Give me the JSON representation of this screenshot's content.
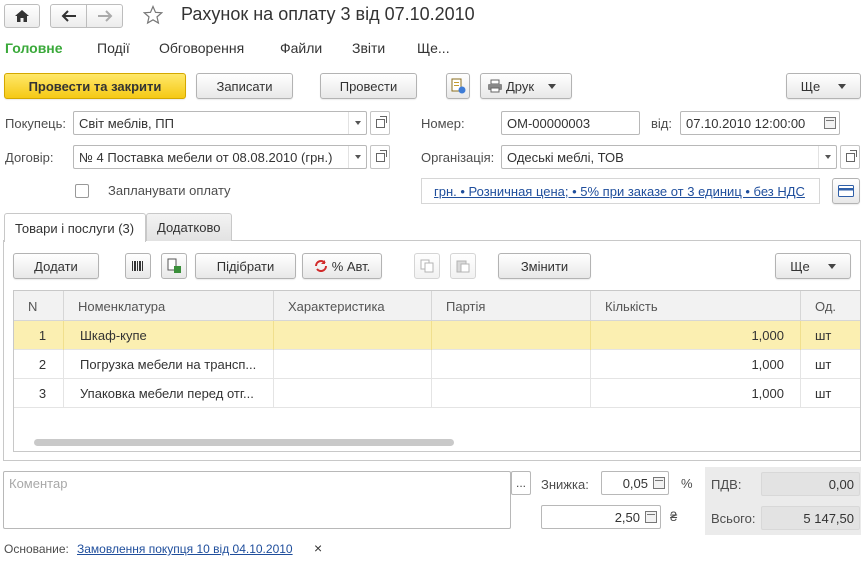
{
  "window": {
    "title": "Рахунок на оплату 3 від 07.10.2010"
  },
  "menu": [
    "Головне",
    "Події",
    "Обговорення",
    "Файли",
    "Звіти",
    "Ще..."
  ],
  "toolbar": {
    "post_close": "Провести та закрити",
    "save": "Записати",
    "post": "Провести",
    "print": "Друк",
    "more": "Ще"
  },
  "header": {
    "buyer_label": "Покупець:",
    "buyer_value": "Світ меблів, ПП",
    "contract_label": "Договір:",
    "contract_value": "№ 4 Поставка мебели от 08.08.2010 (грн.)",
    "plan_payment_label": "Запланувати оплату",
    "number_label": "Номер:",
    "number_value": "ОМ-00000003",
    "date_label": "від:",
    "date_value": "07.10.2010 12:00:00",
    "org_label": "Організація:",
    "org_value": "Одеські меблі, ТОВ",
    "price_link": "грн. • Розничная цена; • 5% при заказе от 3 единиц • без НДС"
  },
  "tabs": [
    "Товари і послуги (3)",
    "Додатково"
  ],
  "table_toolbar": {
    "add": "Додати",
    "pick": "Підібрати",
    "auto_percent": "% Авт.",
    "change": "Змінити",
    "more": "Ще"
  },
  "table": {
    "columns": [
      "N",
      "Номенклатура",
      "Характеристика",
      "Партія",
      "Кількість",
      "Од."
    ],
    "rows": [
      {
        "n": "1",
        "item": "Шкаф-купе",
        "qty": "1,000",
        "unit": "шт"
      },
      {
        "n": "2",
        "item": "Погрузка мебели на трансп...",
        "qty": "1,000",
        "unit": "шт"
      },
      {
        "n": "3",
        "item": "Упаковка мебели перед отг...",
        "qty": "1,000",
        "unit": "шт"
      }
    ]
  },
  "footer": {
    "comment_placeholder": "Коментар",
    "discount_label": "Знижка:",
    "discount_value": "0,05",
    "percent_sign": "%",
    "discount_amount": "2,50",
    "currency_sign": "₴",
    "vat_label": "ПДВ:",
    "vat_value": "0,00",
    "total_label": "Всього:",
    "total_value": "5 147,50",
    "basis_label": "Основание:",
    "basis_link": "Замовлення покупця 10 від 04.10.2010",
    "basis_clear": "×"
  },
  "colors": {
    "accent_green": "#3aa93a",
    "primary_yellow": "#f5c915",
    "selected_row": "#fbefb1",
    "link": "#1f4e9c"
  }
}
